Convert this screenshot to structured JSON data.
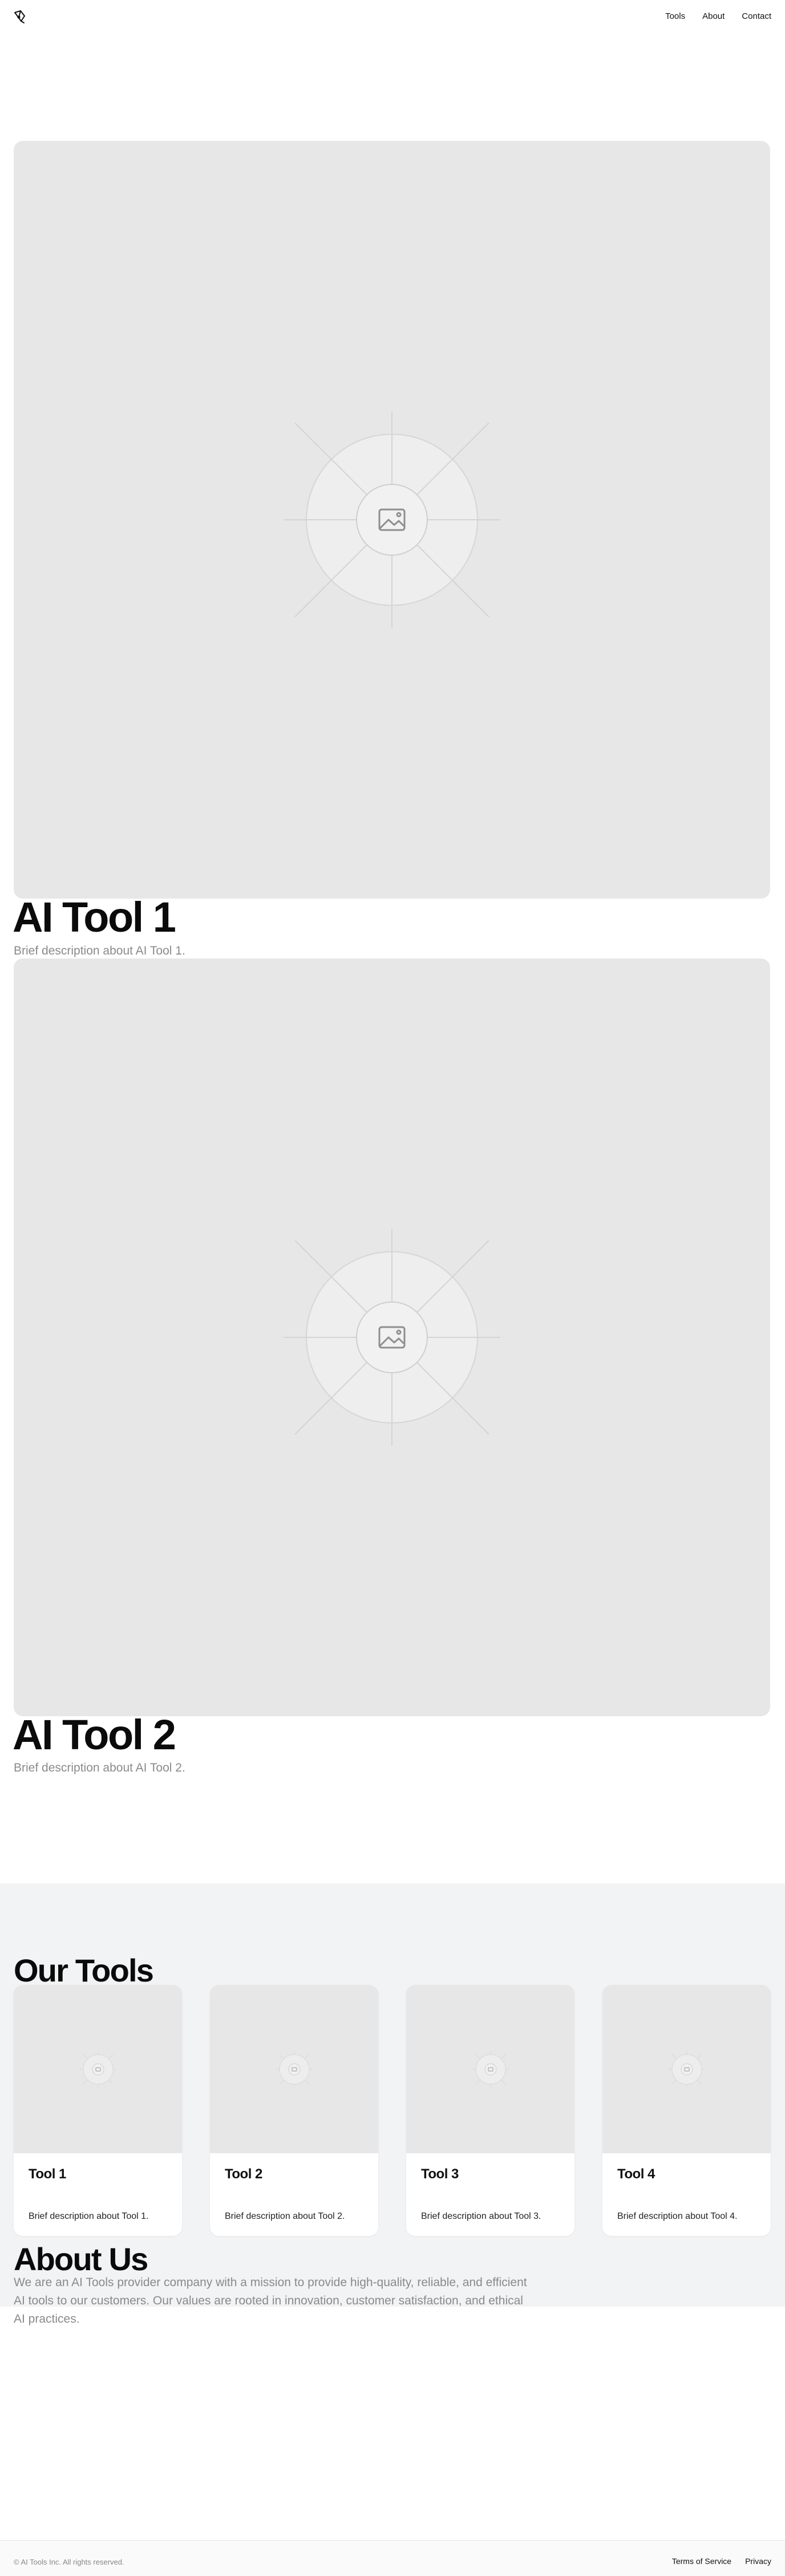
{
  "header": {
    "logo_icon": "pen-nib-icon",
    "nav": [
      "Tools",
      "About",
      "Contact"
    ]
  },
  "hero_items": [
    {
      "title": "AI Tool 1",
      "description": "Brief description about AI Tool 1.",
      "image_icon": "image-placeholder-icon"
    },
    {
      "title": "AI Tool 2",
      "description": "Brief description about AI Tool 2.",
      "image_icon": "image-placeholder-icon"
    }
  ],
  "tools_section": {
    "title": "Our Tools",
    "cards": [
      {
        "title": "Tool 1",
        "description": "Brief description about Tool 1."
      },
      {
        "title": "Tool 2",
        "description": "Brief description about Tool 2."
      },
      {
        "title": "Tool 3",
        "description": "Brief description about Tool 3."
      },
      {
        "title": "Tool 4",
        "description": "Brief description about Tool 4."
      }
    ]
  },
  "about": {
    "title": "About Us",
    "description": "We are an AI Tools provider company with a mission to provide high-quality, reliable, and efficient AI tools to our customers. Our values are rooted in innovation, customer satisfaction, and ethical AI practices."
  },
  "footer": {
    "copyright": "© AI Tools Inc. All rights reserved.",
    "links": [
      "Terms of Service",
      "Privacy"
    ]
  },
  "colors": {
    "placeholder_bg": "#e7e7e7",
    "section_bg": "#f2f3f5",
    "muted_text": "#8a8a8a"
  }
}
